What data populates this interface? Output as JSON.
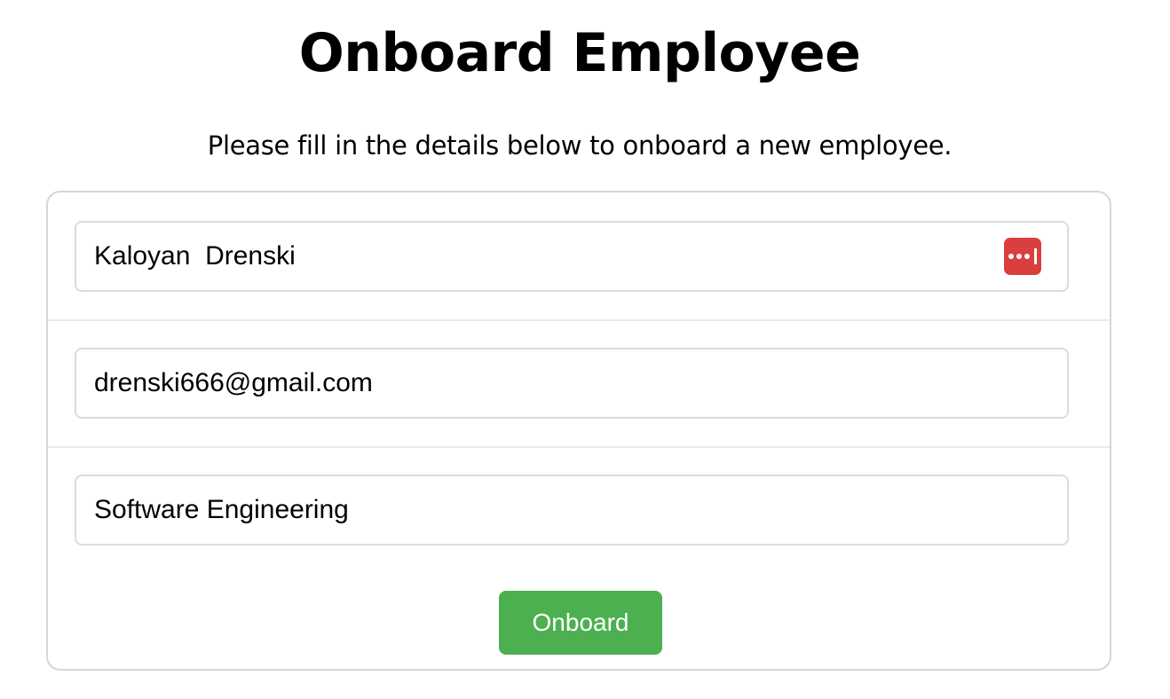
{
  "page": {
    "title": "Onboard Employee",
    "subtitle": "Please fill in the details below to onboard a new employee."
  },
  "form": {
    "name_value": "Kaloyan  Drenski",
    "email_value": "drenski666@gmail.com",
    "department_value": "Software Engineering",
    "password_manager_icon": "password-manager-icon",
    "submit_label": "Onboard"
  },
  "colors": {
    "submit_button": "#4cb050",
    "password_manager_icon": "#d93f3f",
    "card_border": "#d6d6d6"
  }
}
